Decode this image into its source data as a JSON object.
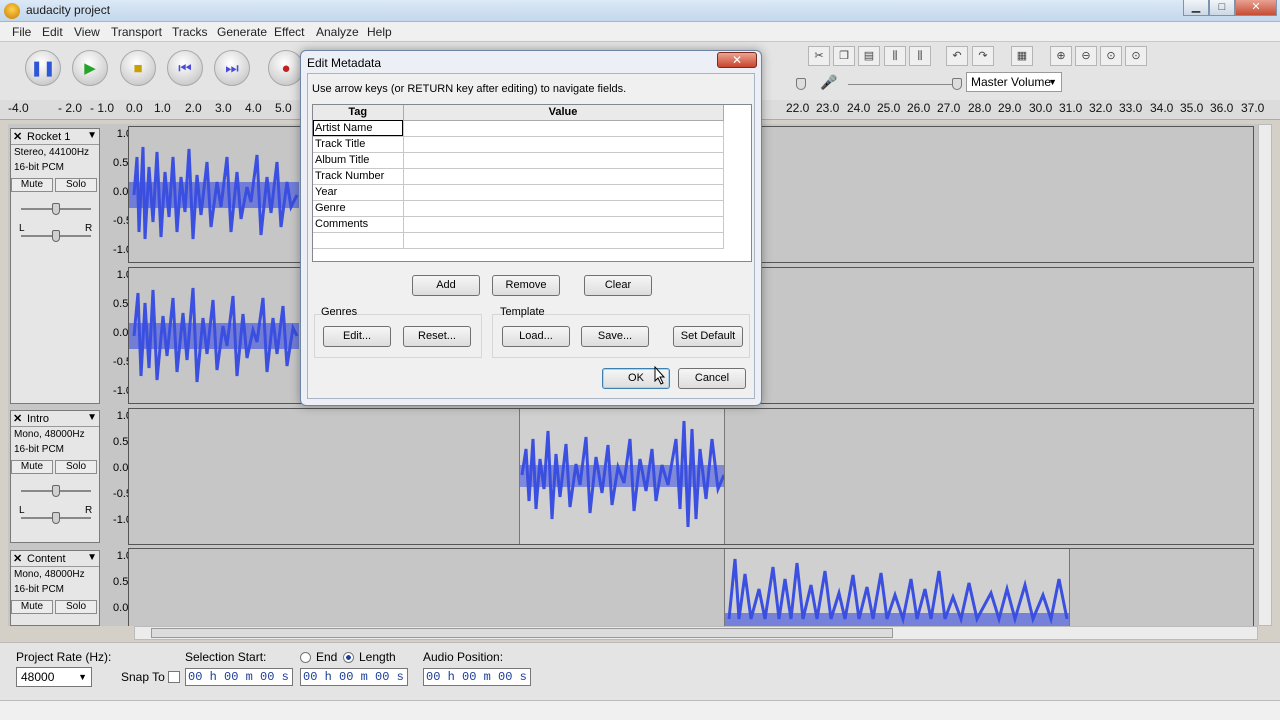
{
  "window": {
    "title": "audacity project",
    "min": "▁",
    "max": "□",
    "close": "✕"
  },
  "menu": [
    "File",
    "Edit",
    "View",
    "Transport",
    "Tracks",
    "Generate",
    "Effect",
    "Analyze",
    "Help"
  ],
  "toolbar": {
    "master_volume": "Master Volume"
  },
  "ruler": [
    "-4.0",
    "- 2.0",
    "- 1.0",
    "0.0",
    "1.0",
    "2.0",
    "3.0",
    "4.0",
    "5.0",
    "22.0",
    "23.0",
    "24.0",
    "25.0",
    "26.0",
    "27.0",
    "28.0",
    "29.0",
    "30.0",
    "31.0",
    "32.0",
    "33.0",
    "34.0",
    "35.0",
    "36.0",
    "37.0"
  ],
  "tracks": [
    {
      "name": "Rocket 1",
      "info1": "Stereo, 44100Hz",
      "info2": "16-bit PCM",
      "mute": "Mute",
      "solo": "Solo",
      "L": "L",
      "R": "R",
      "scale_top": [
        "1.0",
        "0.5-",
        "0.0-",
        "-0.5",
        "-1.0"
      ],
      "scale_bottom": [
        "1.0",
        "0.5-",
        "0.0-",
        "-0.5",
        "-1.0"
      ]
    },
    {
      "name": "Intro",
      "info1": "Mono, 48000Hz",
      "info2": "16-bit PCM",
      "mute": "Mute",
      "solo": "Solo",
      "L": "L",
      "R": "R",
      "scale": [
        "1.0",
        "0.5-",
        "0.0-",
        "-0.5",
        "-1.0"
      ]
    },
    {
      "name": "Content",
      "info1": "Mono, 48000Hz",
      "info2": "16-bit PCM",
      "mute": "Mute",
      "solo": "Solo",
      "scale": [
        "1.0",
        "0.5-",
        "0.0-"
      ]
    }
  ],
  "dialog": {
    "title": "Edit Metadata",
    "hint": "Use arrow keys (or RETURN key after editing) to navigate fields.",
    "col_tag": "Tag",
    "col_value": "Value",
    "rows": [
      "Artist Name",
      "Track Title",
      "Album Title",
      "Track Number",
      "Year",
      "Genre",
      "Comments"
    ],
    "add": "Add",
    "remove": "Remove",
    "clear": "Clear",
    "genres_label": "Genres",
    "template_label": "Template",
    "edit": "Edit...",
    "reset": "Reset...",
    "load": "Load...",
    "save": "Save...",
    "set_default": "Set Default",
    "ok": "OK",
    "cancel": "Cancel"
  },
  "selection_bar": {
    "project_rate_label": "Project Rate (Hz):",
    "project_rate": "48000",
    "snap_to": "Snap To",
    "selection_start": "Selection Start:",
    "end": "End",
    "length": "Length",
    "audio_position": "Audio Position:",
    "time_value": "00 h 00 m 00 s"
  },
  "colors": {
    "waveform": "#3b4fe0",
    "track_bg": "#c6c6c6",
    "selected_clip": "#d0d0d0"
  }
}
